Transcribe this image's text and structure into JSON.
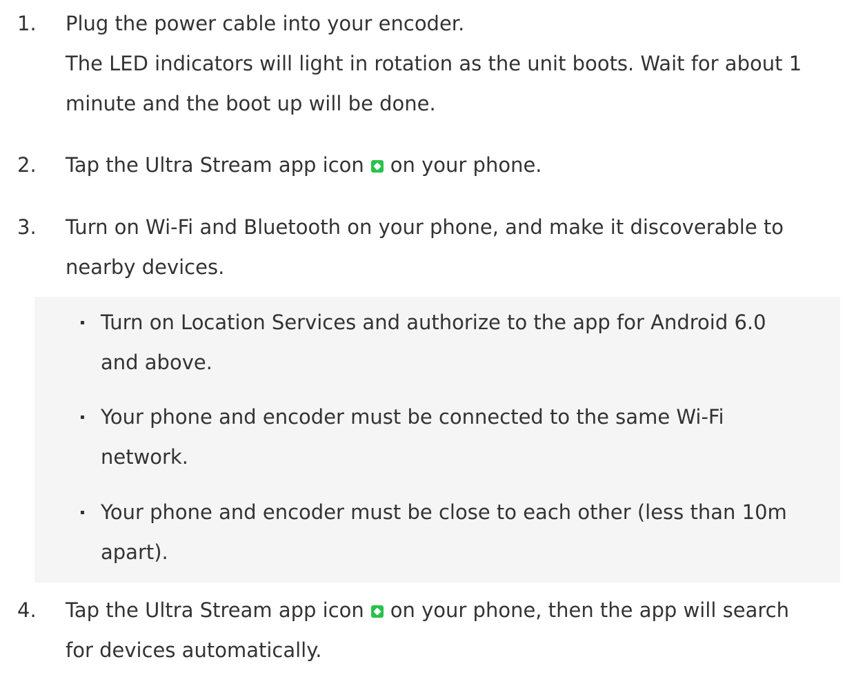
{
  "steps": [
    {
      "number": "1.",
      "line1": "Plug the power cable into your encoder.",
      "line2": "The LED indicators will light in rotation as the unit boots. Wait for about 1",
      "line3": "minute and the boot up will be done."
    },
    {
      "number": "2.",
      "before_icon": "Tap the Ultra Stream app icon",
      "after_icon": "on your phone."
    },
    {
      "number": "3.",
      "line1": "Turn on Wi-Fi and Bluetooth on your phone, and make it discoverable to",
      "line2": "nearby devices."
    },
    {
      "number": "4.",
      "before_icon": "Tap the Ultra Stream app icon",
      "after_icon": "on your phone, then the app will search",
      "line2": "for devices automatically."
    }
  ],
  "notes": [
    {
      "line1": "Turn on Location Services and authorize to the app for Android 6.0",
      "line2": "and above."
    },
    {
      "line1": "Your phone and encoder must be connected to the same Wi-Fi",
      "line2": "network."
    },
    {
      "line1": "Your phone and encoder must be close to each other (less than 10m",
      "line2": "apart)."
    }
  ],
  "icons": {
    "app_icon": "ultra-stream-app-icon"
  },
  "colors": {
    "text": "#333333",
    "note_background": "#f5f5f5",
    "app_icon": "#29c24a",
    "bullet": "#333333"
  }
}
